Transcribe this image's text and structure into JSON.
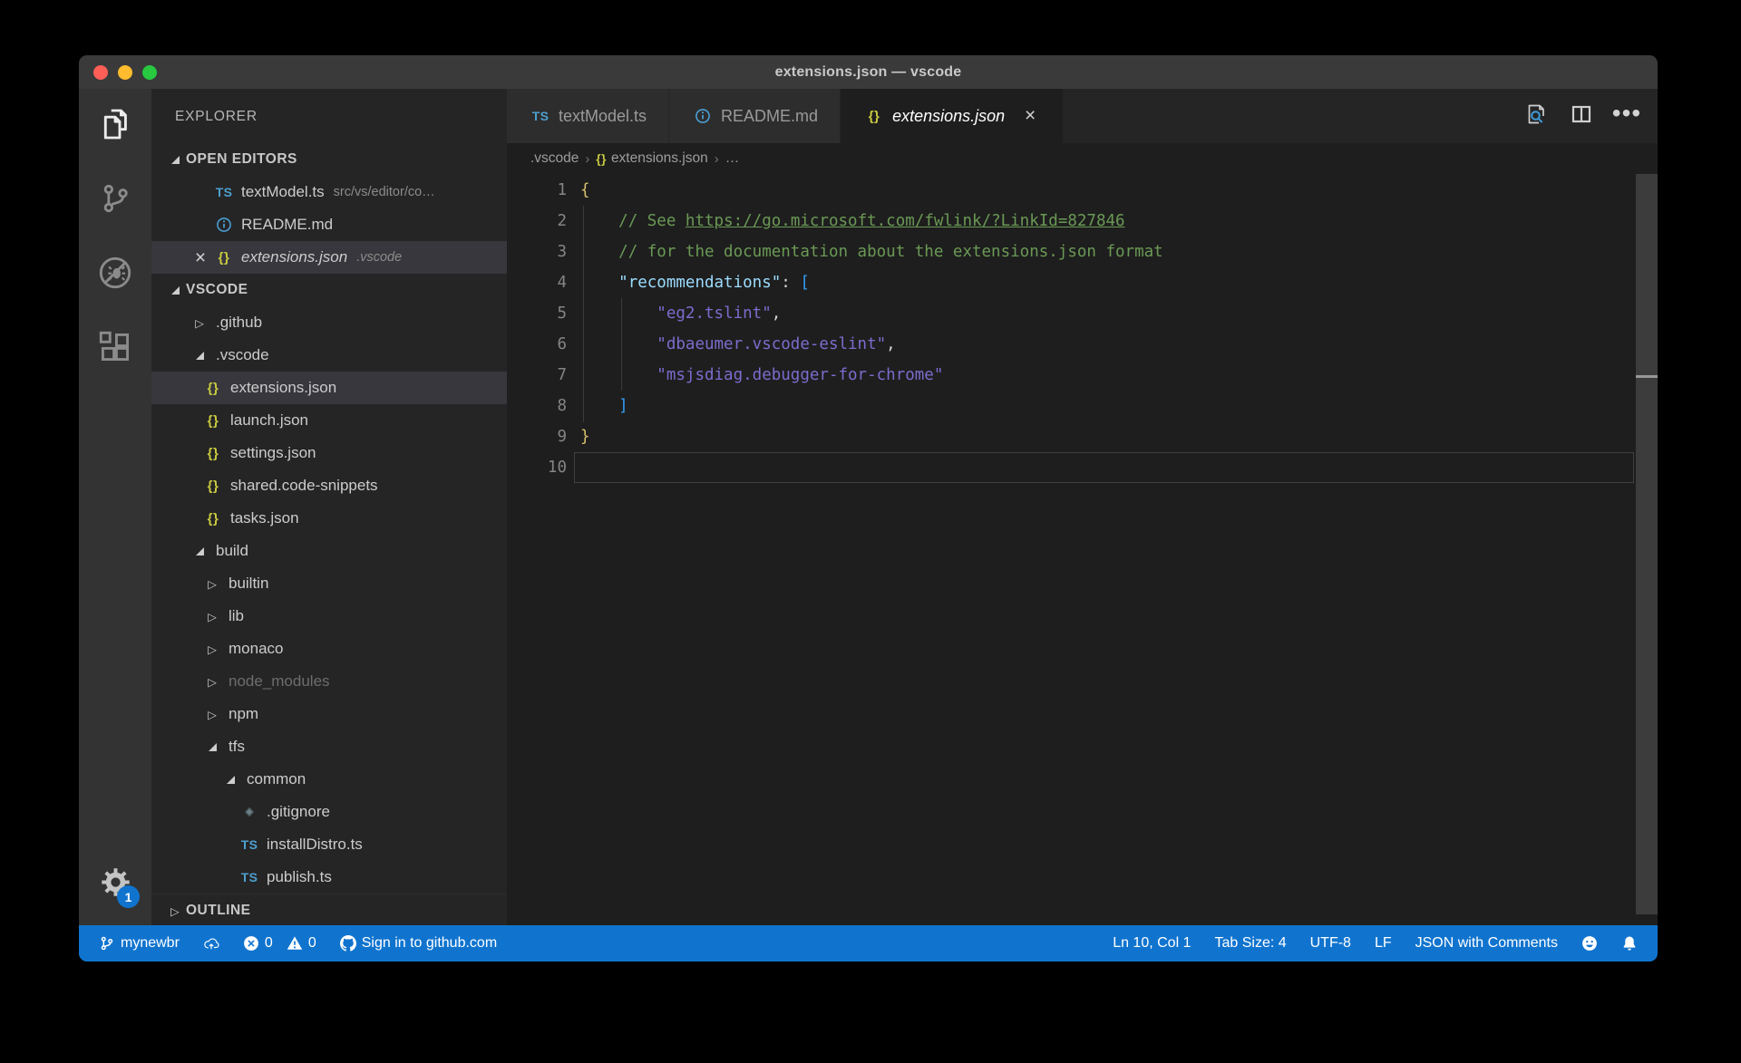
{
  "colors": {
    "statusbar": "#1074cf",
    "titlebar": "#3a3a3a",
    "activitybar": "#333333",
    "sidebar": "#252526",
    "editor_bg": "#1e1e1e",
    "tab_inactive": "#2d2d2d",
    "selection_row": "#37373d",
    "icon_ts": "#4d9fce",
    "icon_braces": "#cbcb41",
    "icon_info": "#4ba0d6",
    "traffic_close": "#ff5f57",
    "traffic_min": "#febc2e",
    "traffic_max": "#28c840",
    "tok_plain": "#d4d4d4",
    "tok_comment": "#6a9955",
    "tok_key": "#9cdcfe",
    "tok_string": "#7b6ccd",
    "tok_brace": "#d9c16d",
    "tok_bracket": "#339cf1"
  },
  "window": {
    "title": "extensions.json — vscode"
  },
  "activity_bar": {
    "items": [
      {
        "name": "explorer",
        "active": true
      },
      {
        "name": "source-control"
      },
      {
        "name": "debug"
      },
      {
        "name": "extensions"
      }
    ],
    "manage": {
      "badge": "1"
    }
  },
  "sidebar": {
    "title": "EXPLORER",
    "open_editors_label": "OPEN EDITORS",
    "open_editors": [
      {
        "label": "textModel.ts",
        "icon": "ts",
        "description": "src/vs/editor/co…"
      },
      {
        "label": "README.md",
        "icon": "info"
      },
      {
        "label": "extensions.json",
        "icon": "braces",
        "description": ".vscode",
        "selected": true,
        "close": true,
        "italic": true
      }
    ],
    "folder_label": "VSCODE",
    "tree": [
      {
        "label": ".github",
        "level": 1,
        "twistie": "collapsed"
      },
      {
        "label": ".vscode",
        "level": 1,
        "twistie": "expanded"
      },
      {
        "label": "extensions.json",
        "level": 2,
        "icon": "braces",
        "selected": true
      },
      {
        "label": "launch.json",
        "level": 2,
        "icon": "braces"
      },
      {
        "label": "settings.json",
        "level": 2,
        "icon": "braces"
      },
      {
        "label": "shared.code-snippets",
        "level": 2,
        "icon": "braces"
      },
      {
        "label": "tasks.json",
        "level": 2,
        "icon": "braces"
      },
      {
        "label": "build",
        "level": 1,
        "twistie": "expanded"
      },
      {
        "label": "builtin",
        "level": 2,
        "twistie": "collapsed"
      },
      {
        "label": "lib",
        "level": 2,
        "twistie": "collapsed"
      },
      {
        "label": "monaco",
        "level": 2,
        "twistie": "collapsed"
      },
      {
        "label": "node_modules",
        "level": 2,
        "twistie": "collapsed",
        "dimmed": true
      },
      {
        "label": "npm",
        "level": 2,
        "twistie": "collapsed"
      },
      {
        "label": "tfs",
        "level": 2,
        "twistie": "expanded"
      },
      {
        "label": "common",
        "level": 3,
        "twistie": "expanded"
      },
      {
        "label": ".gitignore",
        "level": 4,
        "icon": "gitfile"
      },
      {
        "label": "installDistro.ts",
        "level": 4,
        "icon": "ts"
      },
      {
        "label": "publish.ts",
        "level": 4,
        "icon": "ts"
      }
    ],
    "outline_label": "OUTLINE"
  },
  "editor_group": {
    "tabs": [
      {
        "label": "textModel.ts",
        "icon": "ts"
      },
      {
        "label": "README.md",
        "icon": "info"
      },
      {
        "label": "extensions.json",
        "icon": "braces",
        "active": true,
        "italic": true,
        "close": true
      }
    ],
    "actions": [
      {
        "name": "open-preview"
      },
      {
        "name": "split-editor"
      },
      {
        "name": "more-actions"
      }
    ],
    "breadcrumb": [
      {
        "label": ".vscode"
      },
      {
        "label": "extensions.json",
        "icon": "braces"
      },
      {
        "label": "…"
      }
    ]
  },
  "code": {
    "lines": [
      {
        "n": "1",
        "tokens": [
          {
            "t": "{",
            "c": "brace"
          }
        ]
      },
      {
        "n": "2",
        "tokens": [
          {
            "t": "    ",
            "c": "plain"
          },
          {
            "t": "// See ",
            "c": "comment"
          },
          {
            "t": "https://go.microsoft.com/fwlink/?LinkId=827846",
            "c": "comment-link"
          }
        ]
      },
      {
        "n": "3",
        "tokens": [
          {
            "t": "    ",
            "c": "plain"
          },
          {
            "t": "// for the documentation about the extensions.json format",
            "c": "comment"
          }
        ]
      },
      {
        "n": "4",
        "tokens": [
          {
            "t": "    ",
            "c": "plain"
          },
          {
            "t": "\"recommendations\"",
            "c": "key"
          },
          {
            "t": ": ",
            "c": "plain"
          },
          {
            "t": "[",
            "c": "bracket"
          }
        ]
      },
      {
        "n": "5",
        "tokens": [
          {
            "t": "        ",
            "c": "plain"
          },
          {
            "t": "\"eg2.tslint\"",
            "c": "string"
          },
          {
            "t": ",",
            "c": "plain"
          }
        ]
      },
      {
        "n": "6",
        "tokens": [
          {
            "t": "        ",
            "c": "plain"
          },
          {
            "t": "\"dbaeumer.vscode-eslint\"",
            "c": "string"
          },
          {
            "t": ",",
            "c": "plain"
          }
        ]
      },
      {
        "n": "7",
        "tokens": [
          {
            "t": "        ",
            "c": "plain"
          },
          {
            "t": "\"msjsdiag.debugger-for-chrome\"",
            "c": "string"
          }
        ]
      },
      {
        "n": "8",
        "tokens": [
          {
            "t": "    ",
            "c": "plain"
          },
          {
            "t": "]",
            "c": "bracket"
          }
        ]
      },
      {
        "n": "9",
        "tokens": [
          {
            "t": "}",
            "c": "brace"
          }
        ]
      },
      {
        "n": "10",
        "tokens": [],
        "current": true
      }
    ]
  },
  "status_bar": {
    "left": [
      {
        "name": "git-branch",
        "icon": "branch",
        "label": "mynewbr"
      },
      {
        "name": "publish-changes",
        "icon": "cloud-upload"
      },
      {
        "name": "problems",
        "parts": [
          {
            "icon": "error",
            "label": "0"
          },
          {
            "icon": "warning",
            "label": "0"
          }
        ]
      },
      {
        "name": "github-signin",
        "icon": "github",
        "label": "Sign in to github.com"
      }
    ],
    "right": [
      {
        "name": "cursor-position",
        "label": "Ln 10, Col 1"
      },
      {
        "name": "tab-size",
        "label": "Tab Size: 4"
      },
      {
        "name": "encoding",
        "label": "UTF-8"
      },
      {
        "name": "eol",
        "label": "LF"
      },
      {
        "name": "language-mode",
        "label": "JSON with Comments"
      },
      {
        "name": "feedback",
        "icon": "smiley"
      },
      {
        "name": "notifications",
        "icon": "bell"
      }
    ]
  }
}
